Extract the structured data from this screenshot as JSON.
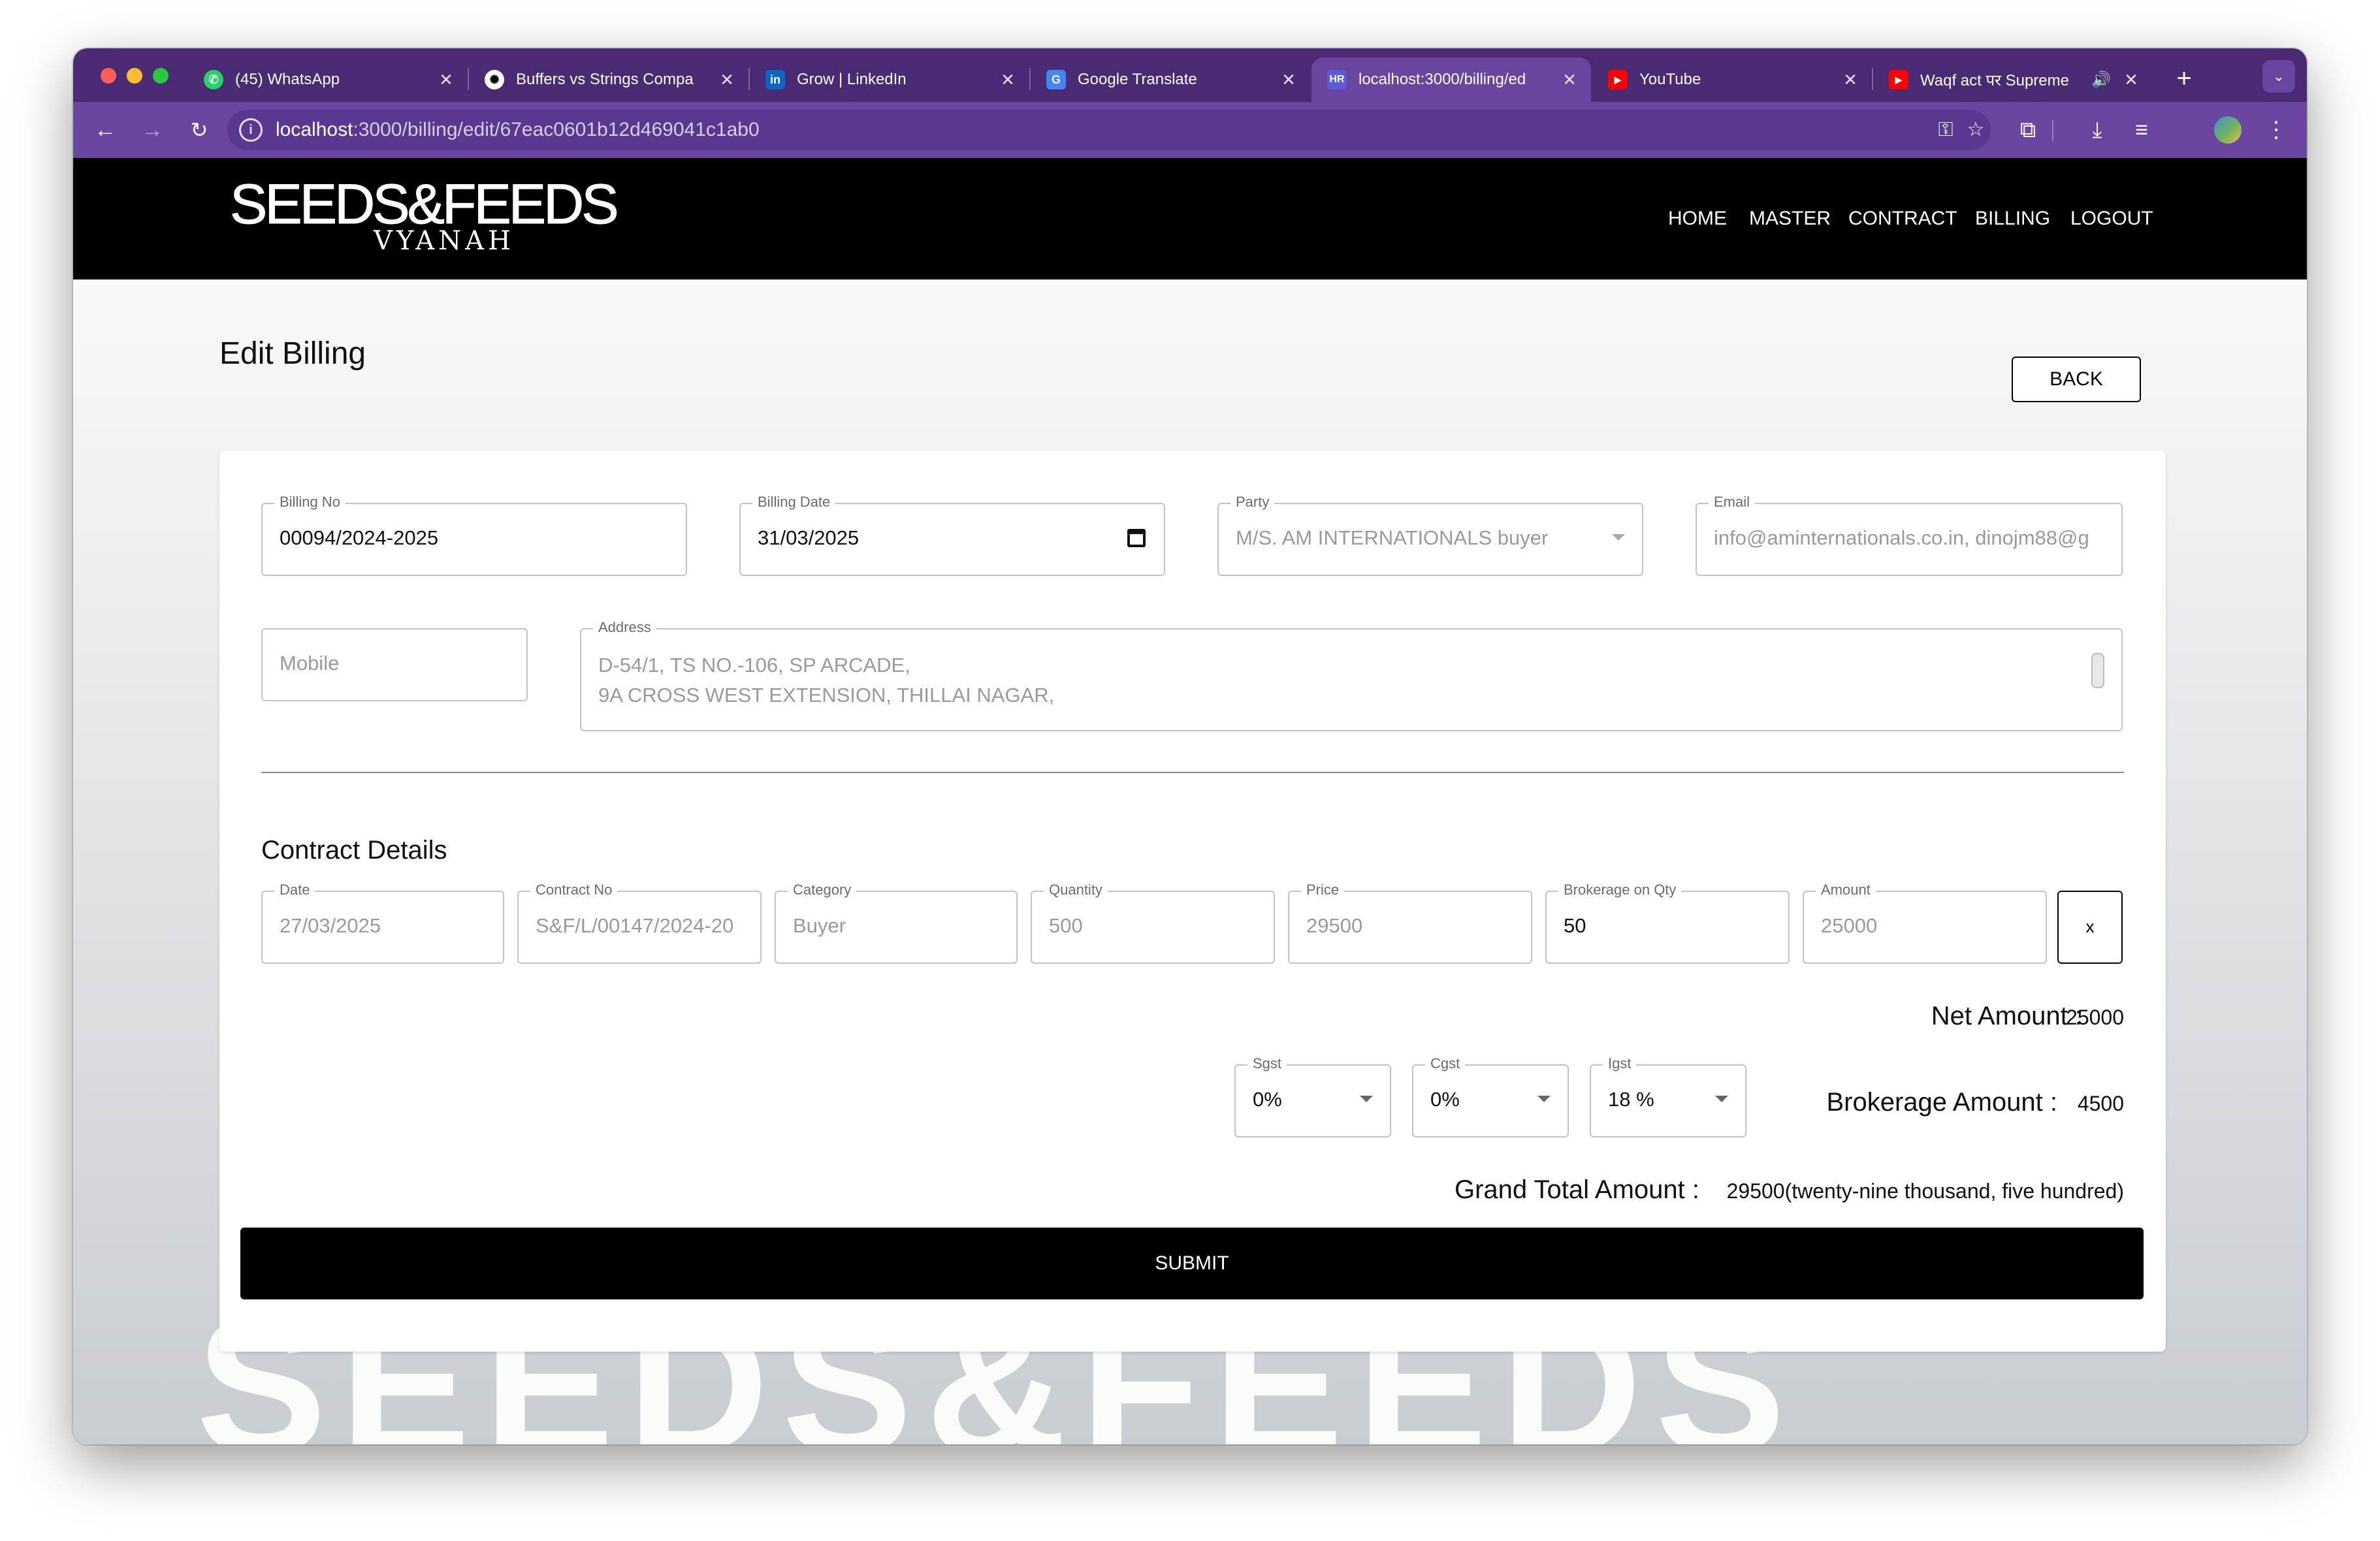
{
  "browser": {
    "tabs": [
      {
        "title": "(45) WhatsApp",
        "icon": "whatsapp-icon"
      },
      {
        "title": "Buffers vs Strings Compa",
        "icon": "openai-icon"
      },
      {
        "title": "Grow | LinkedIn",
        "icon": "linkedin-icon",
        "favicon_text": "in"
      },
      {
        "title": "Google Translate",
        "icon": "google-translate-icon",
        "favicon_text": "G"
      },
      {
        "title": "localhost:3000/billing/ed",
        "icon": "hr-icon",
        "favicon_text": "HR",
        "active": true
      },
      {
        "title": "YouTube",
        "icon": "youtube-icon"
      },
      {
        "title": "Waqf act पर Supreme",
        "icon": "youtube-icon"
      }
    ],
    "url_host": "localhost",
    "url_path": ":3000/billing/edit/67eac0601b12d469041c1ab0",
    "tab_close_glyph": "✕",
    "new_tab_glyph": "+"
  },
  "site": {
    "logo_main": "SEEDS&FEEDS",
    "logo_sub": "VYANAH",
    "nav": [
      "HOME",
      "MASTER",
      "CONTRACT",
      "BILLING",
      "LOGOUT"
    ],
    "watermark": "SEEDS&FEEDS"
  },
  "page": {
    "title": "Edit Billing",
    "back_label": "BACK",
    "billing_no": {
      "label": "Billing No",
      "value": "00094/2024-2025"
    },
    "billing_date": {
      "label": "Billing Date",
      "value": "31/03/2025"
    },
    "party": {
      "label": "Party",
      "value": "M/S. AM INTERNATIONALS buyer"
    },
    "email": {
      "label": "Email",
      "value": "info@aminternationals.co.in, dinojm88@g"
    },
    "mobile": {
      "placeholder": "Mobile"
    },
    "address": {
      "label": "Address",
      "value": "D-54/1, TS NO.-106, SP ARCADE,\n9A CROSS WEST EXTENSION, THILLAI NAGAR,"
    },
    "contract_section_title": "Contract Details",
    "contract_row": {
      "date": {
        "label": "Date",
        "value": "27/03/2025"
      },
      "contract_no": {
        "label": "Contract No",
        "value": "S&F/L/00147/2024-20"
      },
      "category": {
        "label": "Category",
        "value": "Buyer"
      },
      "quantity": {
        "label": "Quantity",
        "value": "500"
      },
      "price": {
        "label": "Price",
        "value": "29500"
      },
      "brokerage_on_qty": {
        "label": "Brokerage on Qty",
        "value": "50"
      },
      "amount": {
        "label": "Amount",
        "value": "25000"
      },
      "remove_label": "x"
    },
    "net_amount_label": "Net Amount :",
    "net_amount_value": "25000",
    "sgst": {
      "label": "Sgst",
      "value": "0%"
    },
    "cgst": {
      "label": "Cgst",
      "value": "0%"
    },
    "igst": {
      "label": "Igst",
      "value": "18 %"
    },
    "brokerage_amount_label": "Brokerage Amount :",
    "brokerage_amount_value": "4500",
    "grand_total_label": "Grand Total Amount :",
    "grand_total_value": "29500(twenty-nine thousand, five hundred)",
    "submit_label": "SUBMIT"
  }
}
